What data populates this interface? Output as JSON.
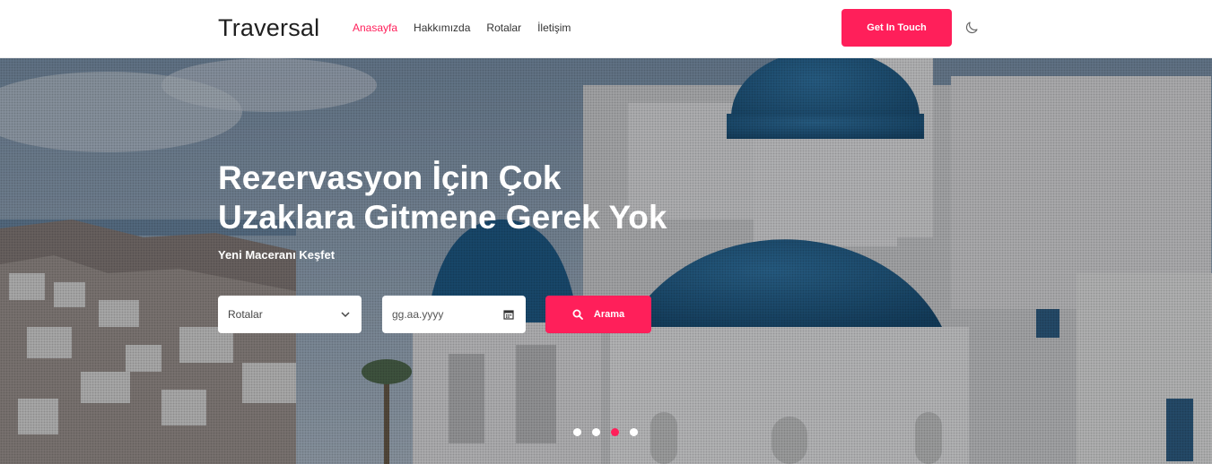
{
  "navbar": {
    "brand": "Traversal",
    "links": [
      {
        "label": "Anasayfa",
        "active": true
      },
      {
        "label": "Hakkımızda",
        "active": false
      },
      {
        "label": "Rotalar",
        "active": false
      },
      {
        "label": "İletişim",
        "active": false
      }
    ],
    "cta_label": "Get In Touch",
    "theme_toggle_icon": "moon-icon"
  },
  "hero": {
    "headline_line1": "Rezervasyon İçin Çok",
    "headline_line2": "Uzaklara Gitmene Gerek Yok",
    "subheadline": "Yeni Maceranı Keşfet",
    "route_select": {
      "value": "Rotalar",
      "icon": "chevron-down-icon"
    },
    "date_input": {
      "placeholder": "gg.aa.yyyy",
      "icon": "calendar-icon"
    },
    "search_button": {
      "label": "Arama",
      "icon": "search-icon"
    },
    "carousel": {
      "slide_count": 4,
      "active_index": 2
    }
  },
  "colors": {
    "accent": "#ff1f5a",
    "text_dark": "#1f1f1f",
    "dome_blue": "#1f5f8f"
  }
}
